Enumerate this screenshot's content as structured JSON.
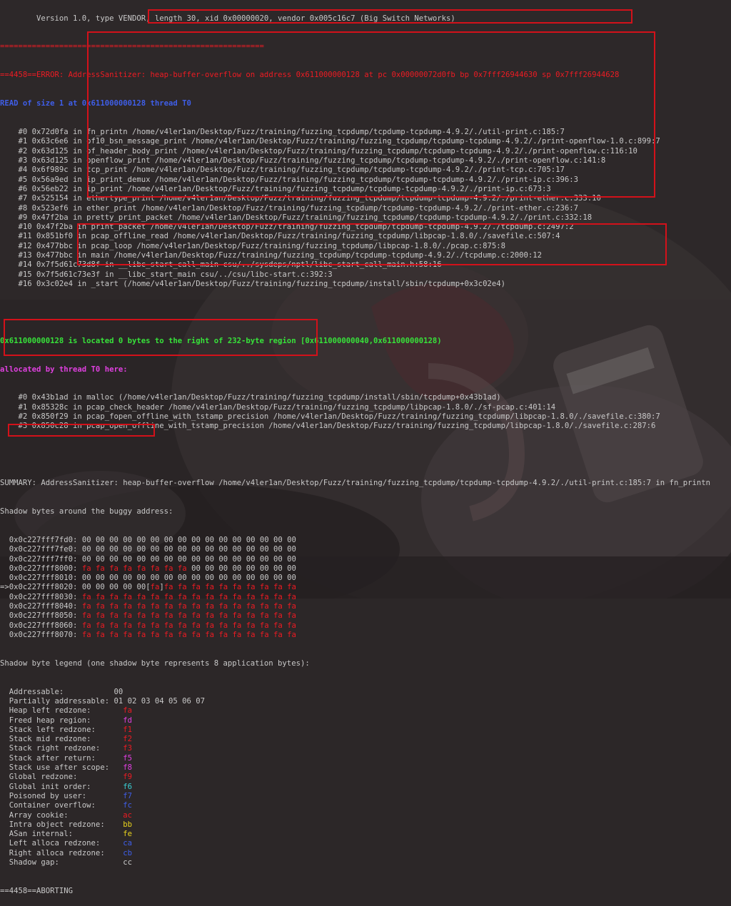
{
  "top_line": "        Version 1.0, type VENDOR, length 30, xid 0x00000020, vendor 0x005c16c7 (Big Switch Networks)",
  "separator": "==========================================================",
  "error_prefix": "==4458==ERROR: AddressSanitizer:",
  "error_detail": " heap-buffer-overflow on address 0x611000000128 at pc 0x00000072d0fb bp 0x7fff26944630 sp 0x7fff26944628",
  "read_line": "READ of size 1 at 0x611000000128 thread T0",
  "stack_frames": [
    "    #0 0x72d0fa in fn_printn /home/v4ler1an/Desktop/Fuzz/training/fuzzing_tcpdump/tcpdump-tcpdump-4.9.2/./util-print.c:185:7",
    "    #1 0x63c6e6 in of10_bsn_message_print /home/v4ler1an/Desktop/Fuzz/training/fuzzing_tcpdump/tcpdump-tcpdump-4.9.2/./print-openflow-1.0.c:899:7",
    "    #2 0x63d125 in of_header_body_print /home/v4ler1an/Desktop/Fuzz/training/fuzzing_tcpdump/tcpdump-tcpdump-4.9.2/./print-openflow.c:116:10",
    "    #3 0x63d125 in openflow_print /home/v4ler1an/Desktop/Fuzz/training/fuzzing_tcpdump/tcpdump-tcpdump-4.9.2/./print-openflow.c:141:8",
    "    #4 0x6f989c in tcp_print /home/v4ler1an/Desktop/Fuzz/training/fuzzing_tcpdump/tcpdump-tcpdump-4.9.2/./print-tcp.c:705:17",
    "    #5 0x56a9ed in ip_print_demux /home/v4ler1an/Desktop/Fuzz/training/fuzzing_tcpdump/tcpdump-tcpdump-4.9.2/./print-ip.c:396:3",
    "    #6 0x56eb22 in ip_print /home/v4ler1an/Desktop/Fuzz/training/fuzzing_tcpdump/tcpdump-tcpdump-4.9.2/./print-ip.c:673:3",
    "    #7 0x525154 in ethertype_print /home/v4ler1an/Desktop/Fuzz/training/fuzzing_tcpdump/tcpdump-tcpdump-4.9.2/./print-ether.c:333:10",
    "    #8 0x523ef6 in ether_print /home/v4ler1an/Desktop/Fuzz/training/fuzzing_tcpdump/tcpdump-tcpdump-4.9.2/./print-ether.c:236:7",
    "    #9 0x47f2ba in pretty_print_packet /home/v4ler1an/Desktop/Fuzz/training/fuzzing_tcpdump/tcpdump-tcpdump-4.9.2/./print.c:332:18",
    "    #10 0x47f2ba in print_packet /home/v4ler1an/Desktop/Fuzz/training/fuzzing_tcpdump/tcpdump-tcpdump-4.9.2/./tcpdump.c:2497:2",
    "    #11 0x851bf0 in pcap_offline_read /home/v4ler1an/Desktop/Fuzz/training/fuzzing_tcpdump/libpcap-1.8.0/./savefile.c:507:4",
    "    #12 0x477bbc in pcap_loop /home/v4ler1an/Desktop/Fuzz/training/fuzzing_tcpdump/libpcap-1.8.0/./pcap.c:875:8",
    "    #13 0x477bbc in main /home/v4ler1an/Desktop/Fuzz/training/fuzzing_tcpdump/tcpdump-tcpdump-4.9.2/./tcpdump.c:2000:12",
    "    #14 0x7f5d61c73d8f in __libc_start_call_main csu/../sysdeps/nptl/libc_start_call_main.h:58:16",
    "    #15 0x7f5d61c73e3f in __libc_start_main csu/../csu/libc-start.c:392:3",
    "    #16 0x3c02e4 in _start (/home/v4ler1an/Desktop/Fuzz/training/fuzzing_tcpdump/install/sbin/tcpdump+0x3c02e4)"
  ],
  "located_line": "0x611000000128 is located 0 bytes to the right of 232-byte region [0x611000000040,0x611000000128)",
  "allocated_line": "allocated by thread T0 here:",
  "alloc_frames": [
    "    #0 0x43b1ad in malloc (/home/v4ler1an/Desktop/Fuzz/training/fuzzing_tcpdump/install/sbin/tcpdump+0x43b1ad)",
    "    #1 0x85328c in pcap_check_header /home/v4ler1an/Desktop/Fuzz/training/fuzzing_tcpdump/libpcap-1.8.0/./sf-pcap.c:401:14",
    "    #2 0x850f29 in pcap_fopen_offline_with_tstamp_precision /home/v4ler1an/Desktop/Fuzz/training/fuzzing_tcpdump/libpcap-1.8.0/./savefile.c:380:7",
    "    #3 0x850c28 in pcap_open_offline_with_tstamp_precision /home/v4ler1an/Desktop/Fuzz/training/fuzzing_tcpdump/libpcap-1.8.0/./savefile.c:287:6"
  ],
  "summary_line": "SUMMARY: AddressSanitizer: heap-buffer-overflow /home/v4ler1an/Desktop/Fuzz/training/fuzzing_tcpdump/tcpdump-tcpdump-4.9.2/./util-print.c:185:7 in fn_printn",
  "shadow_header": "Shadow bytes around the buggy address:",
  "shadow_rows": [
    {
      "prefix": "  0x0c227fff7fd0: ",
      "bytes": [
        "00",
        "00",
        "00",
        "00",
        "00",
        "00",
        "00",
        "00",
        "00",
        "00",
        "00",
        "00",
        "00",
        "00",
        "00",
        "00"
      ],
      "marker": -1
    },
    {
      "prefix": "  0x0c227fff7fe0: ",
      "bytes": [
        "00",
        "00",
        "00",
        "00",
        "00",
        "00",
        "00",
        "00",
        "00",
        "00",
        "00",
        "00",
        "00",
        "00",
        "00",
        "00"
      ],
      "marker": -1
    },
    {
      "prefix": "  0x0c227fff7ff0: ",
      "bytes": [
        "00",
        "00",
        "00",
        "00",
        "00",
        "00",
        "00",
        "00",
        "00",
        "00",
        "00",
        "00",
        "00",
        "00",
        "00",
        "00"
      ],
      "marker": -1
    },
    {
      "prefix": "  0x0c227fff8000: ",
      "bytes": [
        "fa",
        "fa",
        "fa",
        "fa",
        "fa",
        "fa",
        "fa",
        "fa",
        "00",
        "00",
        "00",
        "00",
        "00",
        "00",
        "00",
        "00"
      ],
      "marker": -1
    },
    {
      "prefix": "  0x0c227fff8010: ",
      "bytes": [
        "00",
        "00",
        "00",
        "00",
        "00",
        "00",
        "00",
        "00",
        "00",
        "00",
        "00",
        "00",
        "00",
        "00",
        "00",
        "00"
      ],
      "marker": -1
    },
    {
      "prefix": "=>0x0c227fff8020: ",
      "bytes": [
        "00",
        "00",
        "00",
        "00",
        "00",
        "fa",
        "fa",
        "fa",
        "fa",
        "fa",
        "fa",
        "fa",
        "fa",
        "fa",
        "fa",
        "fa"
      ],
      "marker": 5
    },
    {
      "prefix": "  0x0c227fff8030: ",
      "bytes": [
        "fa",
        "fa",
        "fa",
        "fa",
        "fa",
        "fa",
        "fa",
        "fa",
        "fa",
        "fa",
        "fa",
        "fa",
        "fa",
        "fa",
        "fa",
        "fa"
      ],
      "marker": -1
    },
    {
      "prefix": "  0x0c227fff8040: ",
      "bytes": [
        "fa",
        "fa",
        "fa",
        "fa",
        "fa",
        "fa",
        "fa",
        "fa",
        "fa",
        "fa",
        "fa",
        "fa",
        "fa",
        "fa",
        "fa",
        "fa"
      ],
      "marker": -1
    },
    {
      "prefix": "  0x0c227fff8050: ",
      "bytes": [
        "fa",
        "fa",
        "fa",
        "fa",
        "fa",
        "fa",
        "fa",
        "fa",
        "fa",
        "fa",
        "fa",
        "fa",
        "fa",
        "fa",
        "fa",
        "fa"
      ],
      "marker": -1
    },
    {
      "prefix": "  0x0c227fff8060: ",
      "bytes": [
        "fa",
        "fa",
        "fa",
        "fa",
        "fa",
        "fa",
        "fa",
        "fa",
        "fa",
        "fa",
        "fa",
        "fa",
        "fa",
        "fa",
        "fa",
        "fa"
      ],
      "marker": -1
    },
    {
      "prefix": "  0x0c227fff8070: ",
      "bytes": [
        "fa",
        "fa",
        "fa",
        "fa",
        "fa",
        "fa",
        "fa",
        "fa",
        "fa",
        "fa",
        "fa",
        "fa",
        "fa",
        "fa",
        "fa",
        "fa"
      ],
      "marker": -1
    }
  ],
  "legend_header": "Shadow byte legend (one shadow byte represents 8 application bytes):",
  "legend": [
    {
      "label": "  Addressable:           ",
      "value": "00",
      "color": "#c9c9c9"
    },
    {
      "label": "  Partially addressable: ",
      "value": "01 02 03 04 05 06 07",
      "color": "#c9c9c9"
    },
    {
      "label": "  Heap left redzone:       ",
      "value": "fa",
      "color": "#ee1b23"
    },
    {
      "label": "  Freed heap region:       ",
      "value": "fd",
      "color": "#e040e0"
    },
    {
      "label": "  Stack left redzone:      ",
      "value": "f1",
      "color": "#ee1b23"
    },
    {
      "label": "  Stack mid redzone:       ",
      "value": "f2",
      "color": "#ee1b23"
    },
    {
      "label": "  Stack right redzone:     ",
      "value": "f3",
      "color": "#ee1b23"
    },
    {
      "label": "  Stack after return:      ",
      "value": "f5",
      "color": "#e040e0"
    },
    {
      "label": "  Stack use after scope:   ",
      "value": "f8",
      "color": "#e040e0"
    },
    {
      "label": "  Global redzone:          ",
      "value": "f9",
      "color": "#ee1b23"
    },
    {
      "label": "  Global init order:       ",
      "value": "f6",
      "color": "#39d0d6"
    },
    {
      "label": "  Poisoned by user:        ",
      "value": "f7",
      "color": "#3f5ee8"
    },
    {
      "label": "  Container overflow:      ",
      "value": "fc",
      "color": "#3f5ee8"
    },
    {
      "label": "  Array cookie:            ",
      "value": "ac",
      "color": "#ee1b23"
    },
    {
      "label": "  Intra object redzone:    ",
      "value": "bb",
      "color": "#e8d21d"
    },
    {
      "label": "  ASan internal:           ",
      "value": "fe",
      "color": "#e8d21d"
    },
    {
      "label": "  Left alloca redzone:     ",
      "value": "ca",
      "color": "#3f5ee8"
    },
    {
      "label": "  Right alloca redzone:    ",
      "value": "cb",
      "color": "#3f5ee8"
    },
    {
      "label": "  Shadow gap:              ",
      "value": "cc",
      "color": "#c9c9c9"
    }
  ],
  "aborting_line": "==4458==ABORTING"
}
